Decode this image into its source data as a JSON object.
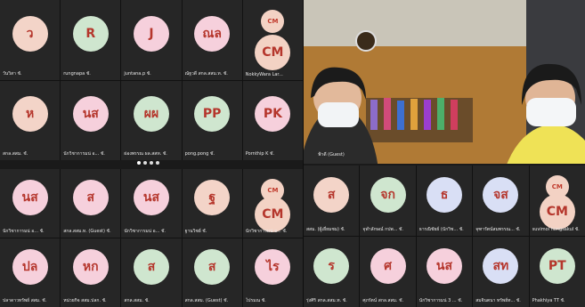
{
  "top_left_grid": {
    "rows": [
      [
        {
          "initials": "ว",
          "color": "#f3d4c8",
          "name": "วันวิสา ชั."
        },
        {
          "initials": "R",
          "color": "#cfe6cf",
          "name": "rungnapa ชั."
        },
        {
          "initials": "J",
          "color": "#f6d0dc",
          "name": "juntana.p ชั."
        },
        {
          "initials": "ณล",
          "color": "#f6d0dc",
          "name": "ณัฐวดี สกล.สสม.ท. ชั."
        },
        {
          "initials": "CM",
          "color": "#f3d2c4",
          "name": "NokkyWara Lar...",
          "cm": true
        }
      ],
      [
        {
          "initials": "ห",
          "color": "#f3d4c8",
          "name": "สกล.สสม. ชั."
        },
        {
          "initials": "นส",
          "color": "#f6d0dc",
          "name": "นักวิชาการมน่ อ... ชั."
        },
        {
          "initials": "ผผ",
          "color": "#cfe6cf",
          "name": "ผ่องพรรณ ผล.สสท. ชั."
        },
        {
          "initials": "PP",
          "color": "#cfe6cf",
          "name": "pong.pong ชั."
        },
        {
          "initials": "PK",
          "color": "#f6d0dc",
          "name": "Pornthip K ชั."
        }
      ]
    ]
  },
  "pager_dots": 4,
  "video_tile": {
    "name": "ฟ้าดี (Guest)"
  },
  "bottom_left_grid": {
    "rows": [
      [
        {
          "initials": "นส",
          "color": "#f6d0dc",
          "name": "นักวิชาการมน่ อ... ชั."
        },
        {
          "initials": "ส",
          "color": "#f6d0dc",
          "name": "สกล.สสม.ท. (Guest) ชั."
        },
        {
          "initials": "นส",
          "color": "#f6d0dc",
          "name": "นักวิชาการมน่ อ... ชั."
        },
        {
          "initials": "ฐ",
          "color": "#f3d4c8",
          "name": "ฐานวิชย์ ชั."
        },
        {
          "initials": "CM",
          "color": "#f3d2c4",
          "name": "นักวิชาการมน่ อ... ชั.",
          "cm": true
        }
      ],
      [
        {
          "initials": "ปล",
          "color": "#f6d0dc",
          "name": "ปลาดาวทรัพย์ สสม. ชั."
        },
        {
          "initials": "หก",
          "color": "#f6d0dc",
          "name": "หน่วยกิจ สสม.ปลก. ชั."
        },
        {
          "initials": "ส",
          "color": "#cfe6cf",
          "name": "สกล.สสม. ชั."
        },
        {
          "initials": "ส",
          "color": "#cfe6cf",
          "name": "สกล.สสม. (Guest) ชั."
        },
        {
          "initials": "ไร",
          "color": "#f6d0dc",
          "name": "ไปรมณ ชั."
        }
      ]
    ]
  },
  "bottom_right_grid": {
    "rows": [
      [
        {
          "initials": "ส",
          "color": "#f3d4c8",
          "name": "สสม. (ผู้เยี่ยมชม) ชั."
        },
        {
          "initials": "จก",
          "color": "#cfe6cf",
          "name": "จุฬาลักษณ์ กปพ... ชั."
        },
        {
          "initials": "ธ",
          "color": "#d9dff5",
          "name": "ธารณิชัยย์ (นักวิช... ชั."
        },
        {
          "initials": "จส",
          "color": "#d9dff5",
          "name": "จุฑารัตน์สมพรรณ... ชั."
        },
        {
          "initials": "CM",
          "color": "#f3d2c4",
          "name": "suvimol hongsakul ชั.",
          "cm": true
        }
      ],
      [
        {
          "initials": "ร",
          "color": "#cfe6cf",
          "name": "รุ่งศิริ สกล.สสม.ท. ชั."
        },
        {
          "initials": "ศ",
          "color": "#f6d0dc",
          "name": "ศุภรัตน์ สกล.สสม. ชั."
        },
        {
          "initials": "นส",
          "color": "#f6d0dc",
          "name": "นักวิชาการมน่ 3 ... ชั."
        },
        {
          "initials": "สท",
          "color": "#d9dff5",
          "name": "สมจินตนา ทรัพย์ท... ชั."
        },
        {
          "initials": "PT",
          "color": "#cfe6cf",
          "name": "Phakhiya TT ชั."
        }
      ]
    ]
  },
  "colors": {
    "initials_text": "#b5362c",
    "tile_bg": "#262626",
    "background": "#1a1a1a"
  }
}
